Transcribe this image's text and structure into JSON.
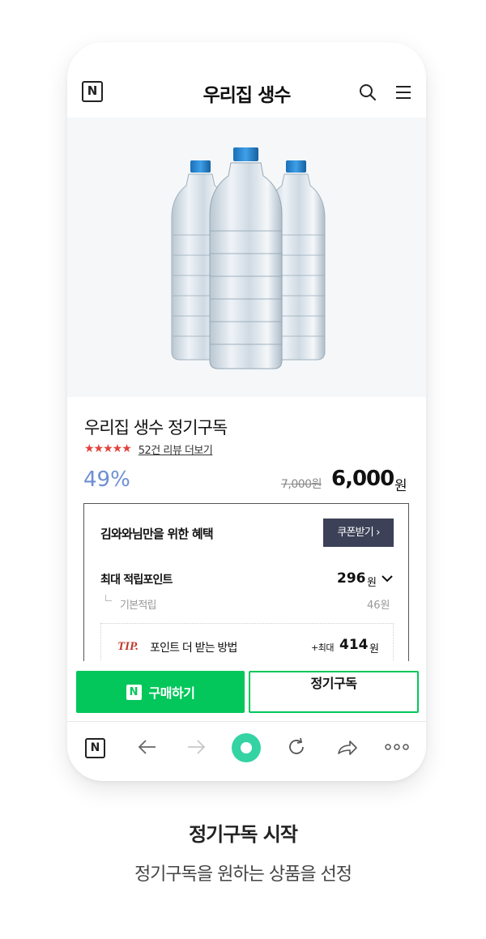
{
  "header": {
    "logo_letter": "N",
    "title": "우리집 생수",
    "search_icon": "search-icon",
    "menu_icon": "hamburger-menu-icon"
  },
  "product": {
    "image": "water-bottles-image",
    "title": "우리집 생수 정기구독",
    "rating_stars": 4.5,
    "stars_text": "★★★★★",
    "review_link": "52건 리뷰 더보기",
    "discount": "49%",
    "original_price": "7,000원",
    "sale_price": "6,000",
    "price_unit": "원"
  },
  "benefits": {
    "title": "김와와님만을 위한 혜택",
    "coupon_button": "쿠폰받기 ›",
    "max_points_label": "최대 적립포인트",
    "max_points_value": "296",
    "points_unit": "원",
    "basic_label": "기본적립",
    "basic_value": "46원",
    "tip_label": "TIP.",
    "tip_text": "포인트 더 받는 방법",
    "tip_max_label": "+최대",
    "tip_max_value": "414",
    "tip_unit": "원"
  },
  "actions": {
    "buy_icon_letter": "N",
    "buy_label": "구매하기",
    "subscribe_label": "정기구독"
  },
  "browser_bar": {
    "logo_letter": "N",
    "icons": [
      "n-logo-icon",
      "back-arrow-icon",
      "forward-arrow-icon",
      "home-circle-icon",
      "refresh-icon",
      "share-icon",
      "more-icon"
    ]
  },
  "caption": {
    "title": "정기구독 시작",
    "subtitle": "정기구독을 원하는 상품을 선정"
  },
  "colors": {
    "naver_green": "#03c75a",
    "star_red": "#e1423b",
    "discount_blue": "#6e8fd4",
    "coupon_dark": "#3c4157",
    "home_mint": "#34d3a4"
  }
}
